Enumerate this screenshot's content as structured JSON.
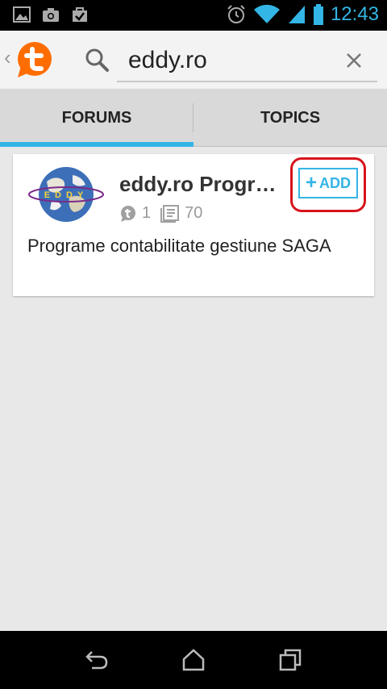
{
  "status_bar": {
    "time": "12:43",
    "icons": [
      "image-icon",
      "camera-icon",
      "bag-check-icon",
      "alarm-icon",
      "wifi-icon",
      "signal-icon",
      "battery-icon"
    ]
  },
  "action_bar": {
    "search_query": "eddy.ro"
  },
  "tabs": [
    {
      "label": "FORUMS",
      "selected": true
    },
    {
      "label": "TOPICS",
      "selected": false
    }
  ],
  "forum_card": {
    "title": "eddy.ro Programe contabilitate gestiune SAGA",
    "topics_count": "1",
    "posts_count": "70",
    "add_label": "ADD",
    "add_plus": "+",
    "description": "Programe contabilitate gestiune SAGA",
    "logo_text": "EDDY"
  },
  "colors": {
    "accent": "#33b5e5",
    "highlight": "#d8131b",
    "logo_orange": "#ff6d00"
  }
}
